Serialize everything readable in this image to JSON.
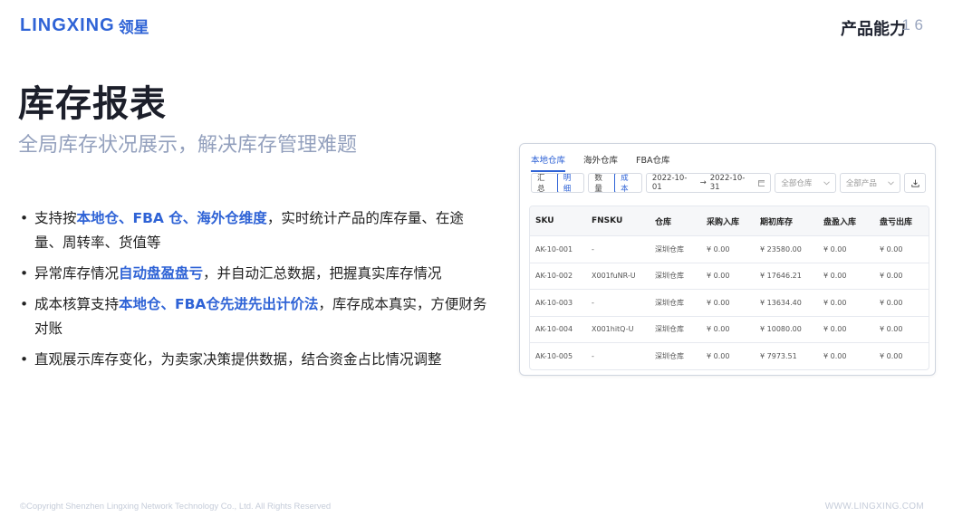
{
  "header": {
    "logo_en": "LINGXING",
    "logo_cn": "领星",
    "section": "产品能力",
    "page_no": "1 6"
  },
  "title": "库存报表",
  "subtitle": "全局库存状况展示，解决库存管理难题",
  "bullets": [
    {
      "pre": "支持按",
      "hl": "本地仓、FBA 仓、海外仓维度",
      "post": "，实时统计产品的库存量、在途量、周转率、货值等"
    },
    {
      "pre": "异常库存情况",
      "hl": "自动盘盈盘亏",
      "post": "，并自动汇总数据，把握真实库存情况"
    },
    {
      "pre": "成本核算支持",
      "hl": "本地仓、FBA仓先进先出计价法",
      "post": "，库存成本真实，方便财务对账"
    },
    {
      "pre": "直观展示库存变化，为卖家决策提供数据，结合资金占比情况调整",
      "hl": "",
      "post": ""
    }
  ],
  "panel": {
    "tabs": [
      "本地仓库",
      "海外仓库",
      "FBA仓库"
    ],
    "seg1": [
      "汇总",
      "明细"
    ],
    "seg2": [
      "数量",
      "成本"
    ],
    "date_start": "2022-10-01",
    "date_arrow": "→",
    "date_end": "2022-10-31",
    "warehouse_select": "全部仓库",
    "product_select": "全部产品",
    "columns": [
      "SKU",
      "FNSKU",
      "仓库",
      "采购入库",
      "期初库存",
      "盘盈入库",
      "盘亏出库"
    ],
    "rows": [
      [
        "AK-10-001",
        "-",
        "深圳仓库",
        "¥ 0.00",
        "¥ 23580.00",
        "¥ 0.00",
        "¥ 0.00"
      ],
      [
        "AK-10-002",
        "X001fuNR-U",
        "深圳仓库",
        "¥ 0.00",
        "¥ 17646.21",
        "¥ 0.00",
        "¥ 0.00"
      ],
      [
        "AK-10-003",
        "-",
        "深圳仓库",
        "¥ 0.00",
        "¥ 13634.40",
        "¥ 0.00",
        "¥ 0.00"
      ],
      [
        "AK-10-004",
        "X001hitQ-U",
        "深圳仓库",
        "¥ 0.00",
        "¥ 10080.00",
        "¥ 0.00",
        "¥ 0.00"
      ],
      [
        "AK-10-005",
        "-",
        "深圳仓库",
        "¥ 0.00",
        "¥ 7973.51",
        "¥ 0.00",
        "¥ 0.00"
      ]
    ]
  },
  "footer": {
    "copyright": "©Copyright Shenzhen Lingxing Network Technology Co., Ltd. All Rights Reserved",
    "website": "WWW.LINGXING.COM"
  },
  "colors": {
    "brand": "#2f63d6",
    "subtitle": "#93a0bd"
  }
}
